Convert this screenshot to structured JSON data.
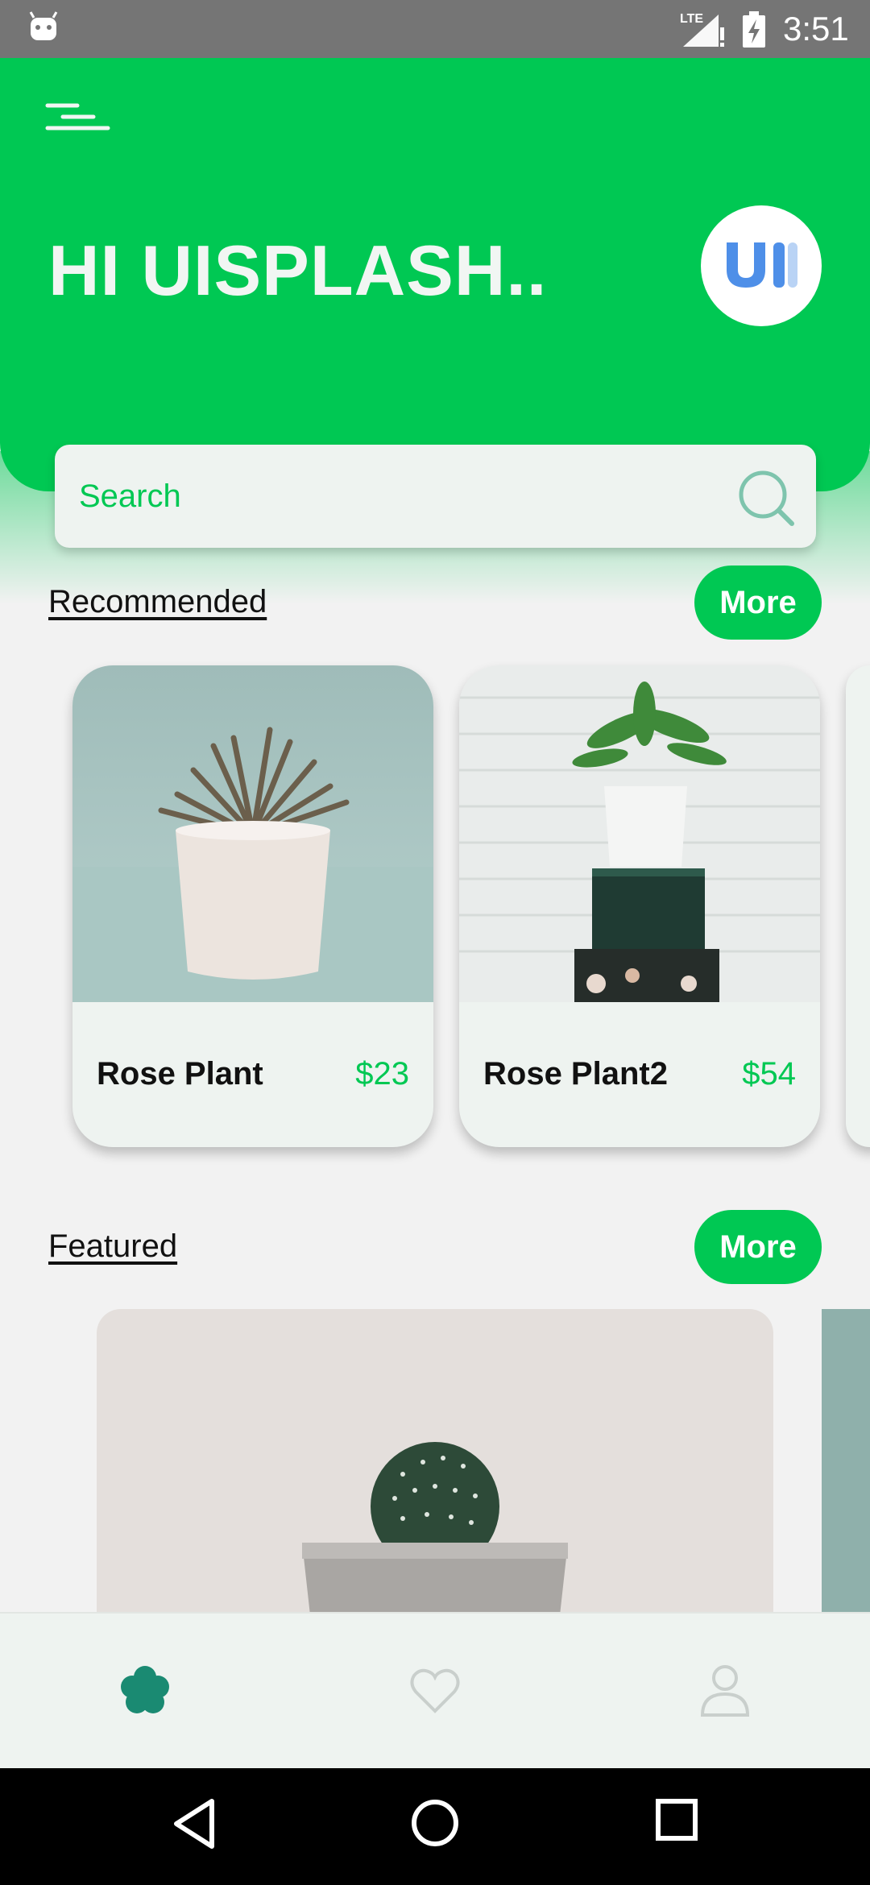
{
  "status_bar": {
    "time": "3:51",
    "network_label": "LTE",
    "icons": [
      "android-icon",
      "lte-signal-icon",
      "battery-charging-icon"
    ]
  },
  "header": {
    "greeting": "HI UISPLASH..",
    "menu_icon": "menu-icon",
    "avatar_icon": "ui-logo-avatar"
  },
  "search": {
    "placeholder": "Search",
    "icon": "search-icon"
  },
  "recommended": {
    "title": "Recommended",
    "more_label": "More",
    "items": [
      {
        "name": "Rose Plant",
        "price": "$23",
        "image": "succulent-in-white-pot"
      },
      {
        "name": "Rose Plant2",
        "price": "$54",
        "image": "plant-on-stacked-boxes"
      }
    ]
  },
  "featured": {
    "title": "Featured",
    "more_label": "More",
    "image": "cactus-in-grey-pot"
  },
  "bottom_nav": {
    "items": [
      "home-flower-icon",
      "favorites-heart-icon",
      "profile-user-icon"
    ],
    "active_index": 0
  },
  "system_nav": {
    "items": [
      "back-icon",
      "home-icon",
      "recents-icon"
    ]
  },
  "colors": {
    "accent": "#00c853",
    "status_bar": "#757575",
    "card_background": "#eef3f0",
    "page_background": "#f2f2f2",
    "active_nav_icon": "#1a8a72",
    "inactive_nav_icon": "#c9cfcc"
  }
}
